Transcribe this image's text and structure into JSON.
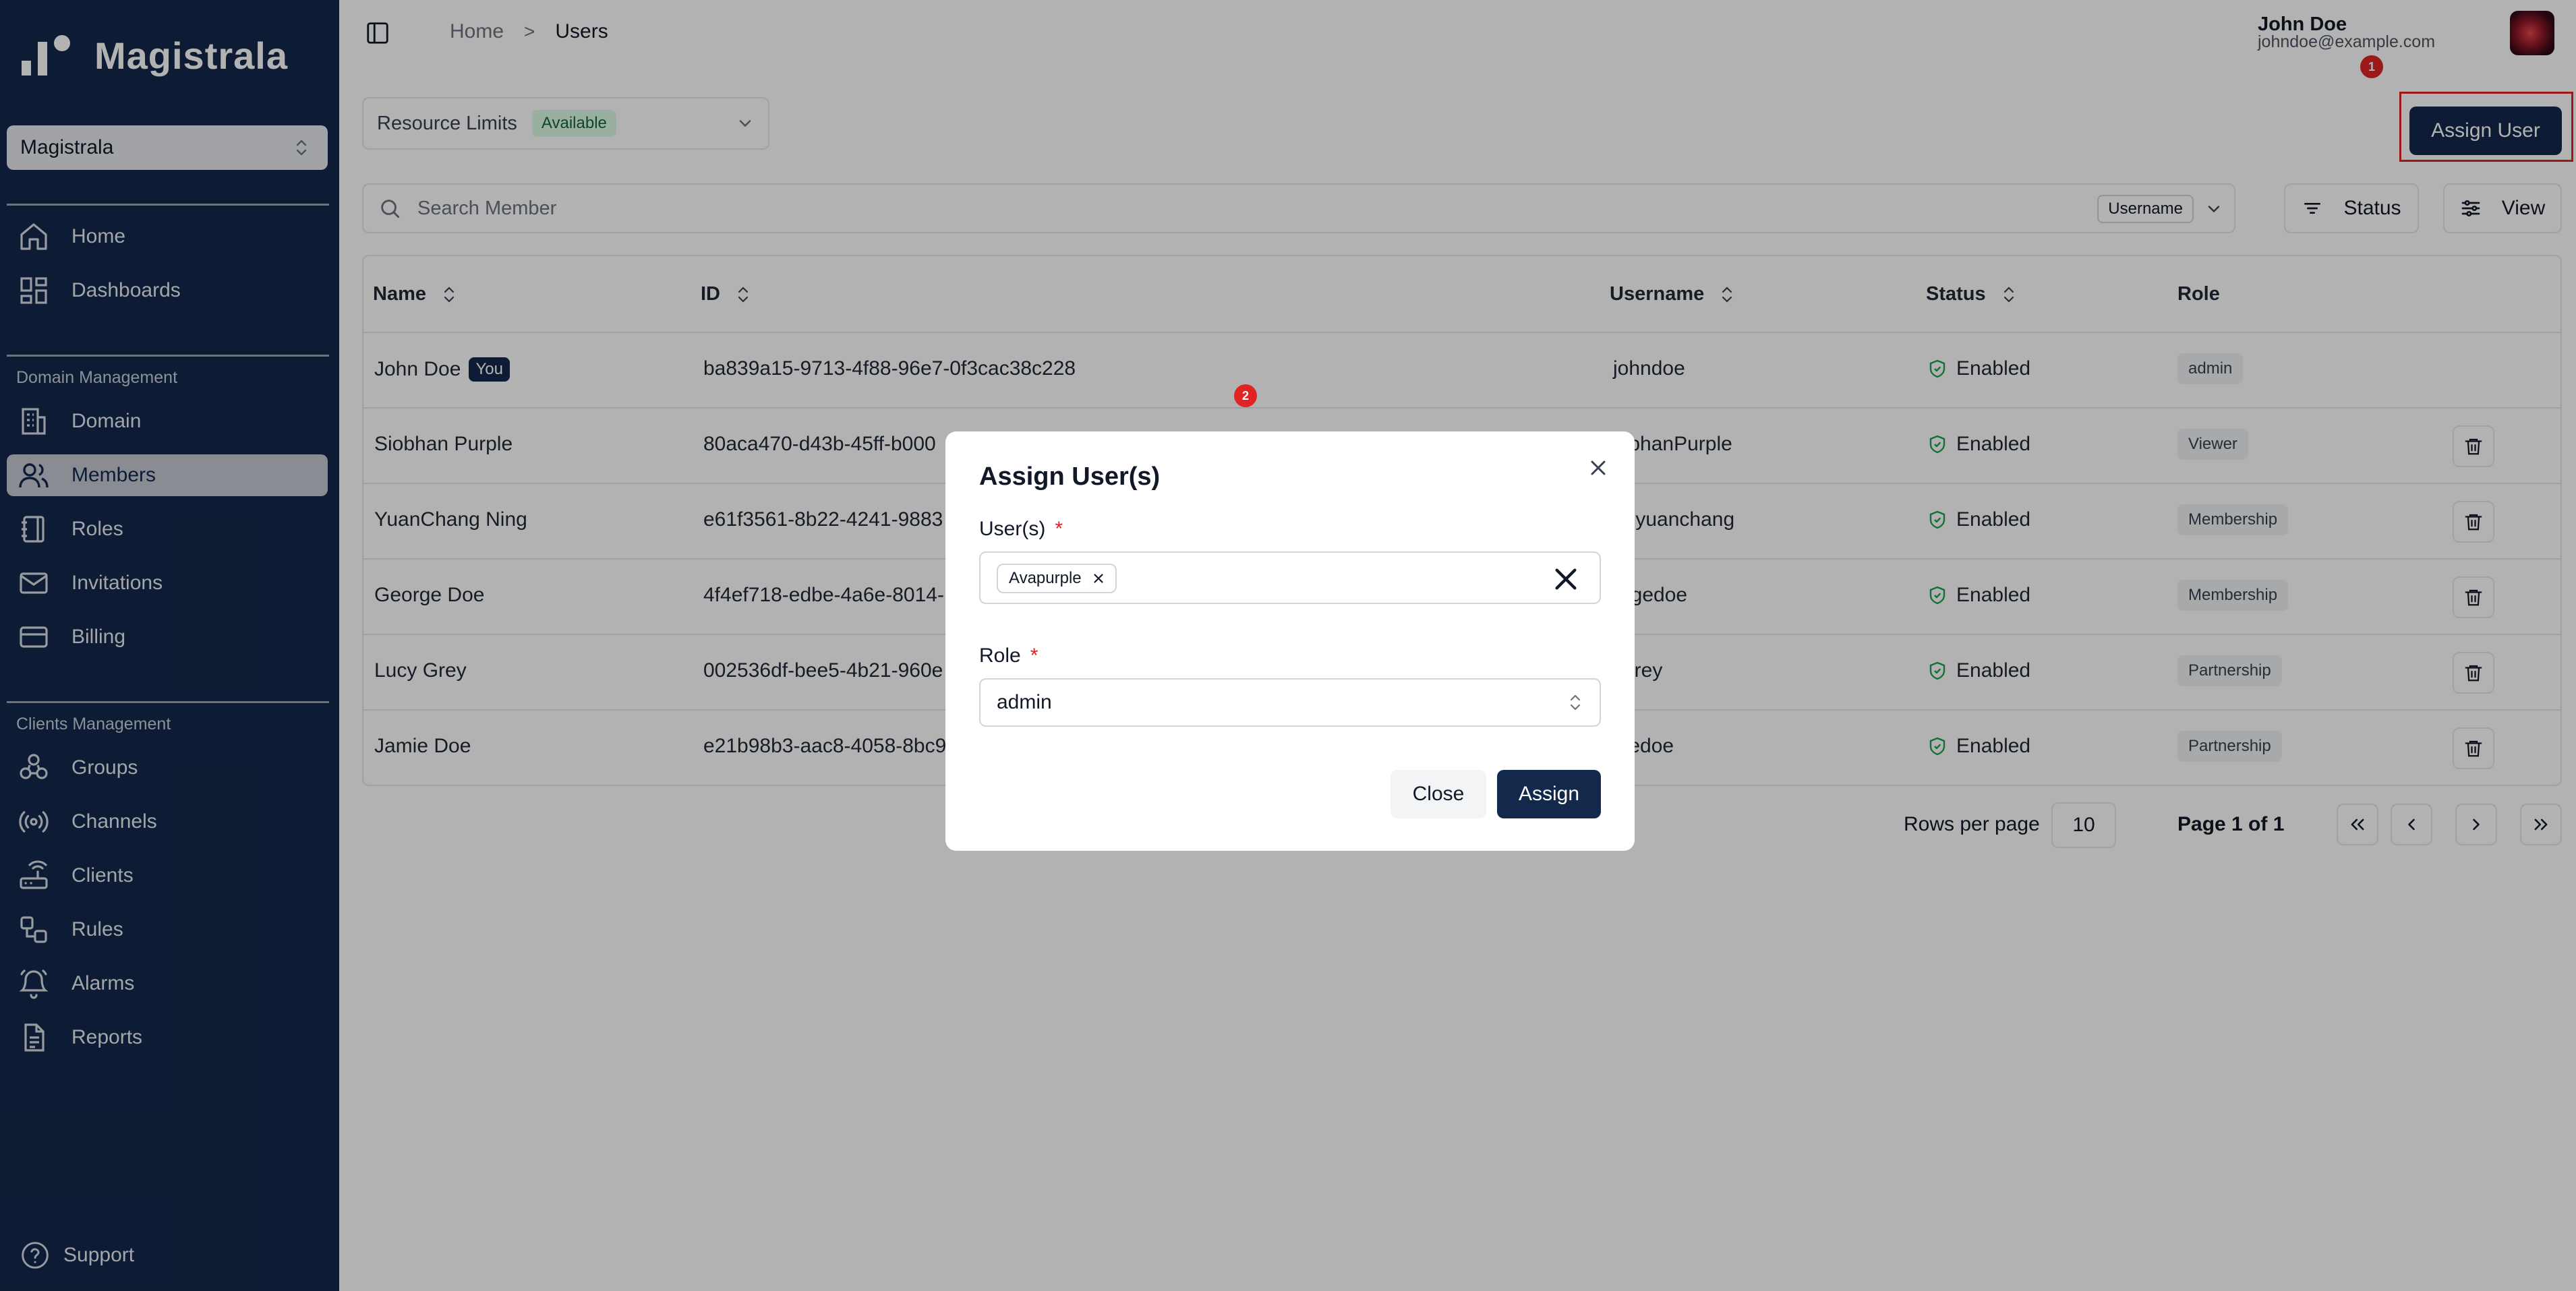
{
  "app": {
    "brand": "Magistrala"
  },
  "sidebar": {
    "domain_selector": "Magistrala",
    "items_top": [
      {
        "label": "Home",
        "icon": "home-icon"
      },
      {
        "label": "Dashboards",
        "icon": "dashboard-icon"
      }
    ],
    "domain_section": "Domain Management",
    "items_domain": [
      {
        "label": "Domain",
        "icon": "building-icon"
      },
      {
        "label": "Members",
        "icon": "users-icon",
        "active": true
      },
      {
        "label": "Roles",
        "icon": "notebook-icon"
      },
      {
        "label": "Invitations",
        "icon": "mail-icon"
      },
      {
        "label": "Billing",
        "icon": "credit-card-icon"
      }
    ],
    "clients_section": "Clients Management",
    "items_clients": [
      {
        "label": "Groups",
        "icon": "groups-icon"
      },
      {
        "label": "Channels",
        "icon": "radio-icon"
      },
      {
        "label": "Clients",
        "icon": "router-icon"
      },
      {
        "label": "Rules",
        "icon": "workflow-icon"
      },
      {
        "label": "Alarms",
        "icon": "bell-icon"
      },
      {
        "label": "Reports",
        "icon": "report-icon"
      }
    ],
    "support": "Support"
  },
  "header": {
    "breadcrumb_home": "Home",
    "breadcrumb_sep": ">",
    "breadcrumb_current": "Users",
    "user_name": "John Doe",
    "user_email": "johndoe@example.com"
  },
  "toolbar": {
    "resource_limits": "Resource Limits",
    "resource_status": "Available",
    "assign_user": "Assign User",
    "search_placeholder": "Search Member",
    "search_field": "Username",
    "status_filter": "Status",
    "view": "View"
  },
  "table": {
    "headers": {
      "name": "Name",
      "id": "ID",
      "username": "Username",
      "status": "Status",
      "role": "Role"
    },
    "you_badge": "You",
    "rows": [
      {
        "name": "John Doe",
        "you": true,
        "id": "ba839a15-9713-4f88-96e7-0f3cac38c228",
        "username": "johndoe",
        "status": "Enabled",
        "role": "admin"
      },
      {
        "name": "Siobhan Purple",
        "id": "80aca470-d43b-45ff-b000",
        "username": "iobhanPurple",
        "status": "Enabled",
        "role": "Viewer"
      },
      {
        "name": "YuanChang Ning",
        "id": "e61f3561-8b22-4241-9883",
        "username": "ngyuanchang",
        "status": "Enabled",
        "role": "Membership"
      },
      {
        "name": "George Doe",
        "id": "4f4ef718-edbe-4a6e-8014-",
        "username": "orgedoe",
        "status": "Enabled",
        "role": "Membership"
      },
      {
        "name": "Lucy Grey",
        "id": "002536df-bee5-4b21-960e",
        "username": "ygrey",
        "status": "Enabled",
        "role": "Partnership"
      },
      {
        "name": "Jamie Doe",
        "id": "e21b98b3-aac8-4058-8bc9",
        "username": "niedoe",
        "status": "Enabled",
        "role": "Partnership"
      }
    ]
  },
  "pagination": {
    "rows_per_page_label": "Rows per page",
    "rows_per_page": "10",
    "page_info": "Page 1 of 1"
  },
  "markers": {
    "m1": "1",
    "m2": "2"
  },
  "dialog": {
    "title": "Assign User(s)",
    "users_label": "User(s)",
    "required": "*",
    "selected_user": "Avapurple",
    "role_label": "Role",
    "role_value": "admin",
    "close": "Close",
    "assign": "Assign"
  },
  "colors": {
    "navy": "#13294b",
    "marker": "#e02424",
    "available_bg": "#dcfce7"
  }
}
